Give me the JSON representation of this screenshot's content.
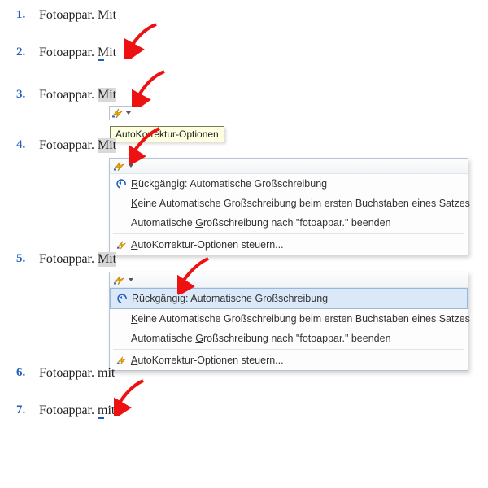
{
  "rows": {
    "r1": {
      "num": "1.",
      "text_a": "Fotoappar. ",
      "text_b": "Mit"
    },
    "r2": {
      "num": "2.",
      "text_a": "Fotoappar. ",
      "text_b": "Mit"
    },
    "r3": {
      "num": "3.",
      "text_a": "Fotoappar. ",
      "text_b": "Mit"
    },
    "r4": {
      "num": "4.",
      "text_a": "Fotoappar. ",
      "text_b": "Mit"
    },
    "r5": {
      "num": "5.",
      "text_a": "Fotoappar. ",
      "text_b": "Mit"
    },
    "r6": {
      "num": "6.",
      "text_a": "Fotoappar. ",
      "text_b": "mit"
    },
    "r7": {
      "num": "7.",
      "text_a": "Fotoappar. ",
      "text_b": "mit"
    }
  },
  "tooltip": "AutoKorrektur-Optionen",
  "menu": {
    "undo": "Rückgängig: Automatische Großschreibung",
    "no_auto": "Keine Automatische Großschreibung beim ersten Buchstaben eines Satzes",
    "stop_after": "Automatische Großschreibung nach \"fotoappar.\" beenden",
    "control": "AutoKorrektur-Optionen steuern..."
  },
  "mnemonics": {
    "undo": "R",
    "no_auto": "K",
    "stop_after": "G",
    "control": "A"
  }
}
